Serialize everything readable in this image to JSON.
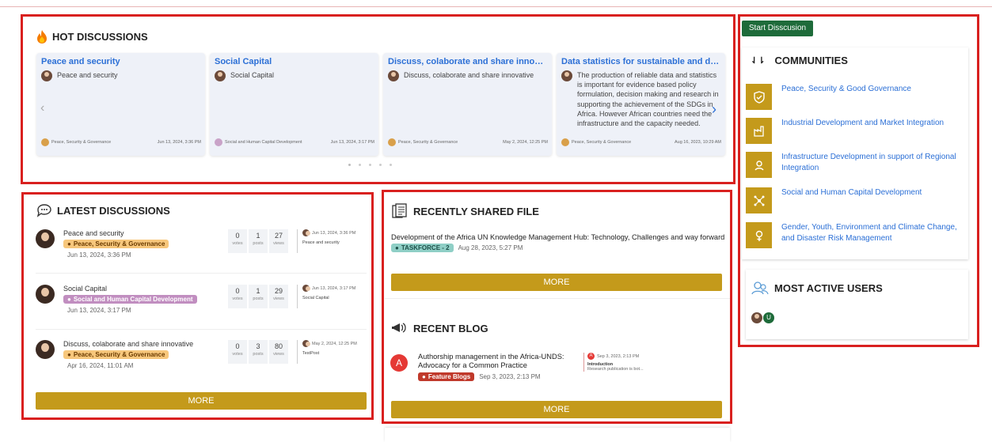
{
  "hot": {
    "title": "HOT DISCUSSIONS",
    "cards": [
      {
        "title": "Peace and security",
        "body": "Peace and security",
        "category": "Peace, Security & Governance",
        "date": "Jun 13, 2024, 3:36 PM"
      },
      {
        "title": "Social Capital",
        "body": "Social Capital",
        "category": "Social and Human Capital Development",
        "date": "Jun 13, 2024, 3:17 PM"
      },
      {
        "title": "Discuss, colaborate and share innovative",
        "body": "Discuss, colaborate and share innovative",
        "category": "Peace, Security & Governance",
        "date": "May 2, 2024, 12:25 PM"
      },
      {
        "title": "Data statistics for sustainable and develo...",
        "body": "The production of reliable data and statistics is important for evidence based policy formulation, decision making and research in supporting the achievement of the SDGs in Africa. However African countries need the infrastructure and the capacity needed.",
        "category": "Peace, Security & Governance",
        "date": "Aug 16, 2023, 10:29 AM"
      }
    ],
    "prev": "‹",
    "next": "›"
  },
  "latest": {
    "title": "LATEST DISCUSSIONS",
    "stat_labels": {
      "votes": "votes",
      "posts": "posts",
      "views": "views"
    },
    "rows": [
      {
        "name": "Peace and security",
        "tag": "Peace, Security & Governance",
        "date": "Jun 13, 2024, 3:36 PM",
        "votes": "0",
        "posts": "1",
        "views": "27",
        "last_date": "Jun 13, 2024, 3:36 PM",
        "last_title": "Peace and security"
      },
      {
        "name": "Social Capital",
        "tag": "Social and Human Capital Development",
        "date": "Jun 13, 2024, 3:17 PM",
        "votes": "0",
        "posts": "1",
        "views": "29",
        "last_date": "Jun 13, 2024, 3:17 PM",
        "last_title": "Social Capital"
      },
      {
        "name": "Discuss, colaborate and share innovative",
        "tag": "Peace, Security & Governance",
        "date": "Apr 16, 2024, 11:01 AM",
        "votes": "0",
        "posts": "3",
        "views": "80",
        "last_date": "May 2, 2024, 12:25 PM",
        "last_title": "TestPost"
      }
    ],
    "more": "MORE"
  },
  "files": {
    "title": "RECENTLY SHARED FILE",
    "item_title": "Development of the Africa UN Knowledge Management Hub: Technology, Challenges and way forward",
    "tag": "TASKFORCE - 2",
    "date": "Aug 28, 2023, 5:27 PM",
    "more": "MORE"
  },
  "blog": {
    "title": "RECENT BLOG",
    "avatar_letter": "A",
    "item_title": "Authorship management in the Africa-UNDS: Advocacy for a Common Practice",
    "tag": "Feature Blogs",
    "date": "Sep 3, 2023, 2:13 PM",
    "last_date": "Sep 3, 2023, 2:13 PM",
    "last_heading": "Introduction",
    "last_excerpt": "Research publication is bot...",
    "more": "MORE"
  },
  "sidebar": {
    "start_button": "Start Disscusion",
    "communities_title": "COMMUNITIES",
    "communities": [
      {
        "label": "Peace, Security & Good Governance",
        "icon": "shield-icon"
      },
      {
        "label": "Industrial Development and Market Integration",
        "icon": "factory-icon"
      },
      {
        "label": "Infrastructure Development in support of Regional Integration",
        "icon": "gear-hand-icon"
      },
      {
        "label": "Social and Human Capital Development",
        "icon": "network-icon"
      },
      {
        "label": "Gender, Youth, Environment and Climate Change, and Disaster Risk Management",
        "icon": "gender-icon"
      }
    ],
    "active_users_title": "MOST ACTIVE USERS",
    "user_letter": "U"
  },
  "colors": {
    "accent": "#c49a1b",
    "link": "#2b6fd6",
    "highlight": "#d9201f",
    "start_button": "#1e6b3a"
  }
}
